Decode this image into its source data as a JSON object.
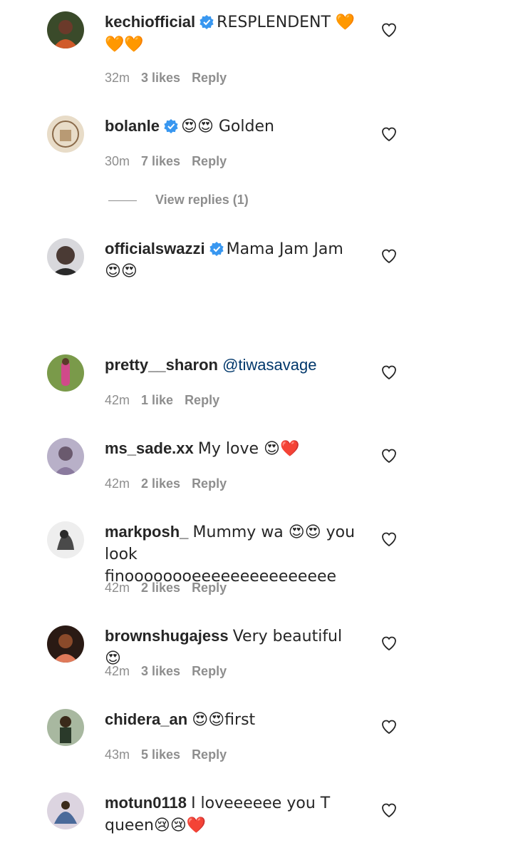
{
  "comments": [
    {
      "username": "kechiofficial",
      "verified": true,
      "text": "RESPLENDENT 🧡🧡🧡",
      "mention": "",
      "time": "32m",
      "likes": "3 likes",
      "reply": "Reply",
      "avatar_color": "#c0502a"
    },
    {
      "username": "bolanle",
      "verified": true,
      "text": "😍😍 Golden",
      "mention": "",
      "time": "30m",
      "likes": "7 likes",
      "reply": "Reply",
      "avatar_color": "#b89a74"
    },
    {
      "username": "officialswazzi",
      "verified": true,
      "text": "Mama Jam Jam 😍😍",
      "mention": "",
      "time": "",
      "likes": "",
      "reply": "",
      "avatar_color": "#3e3a3a"
    },
    {
      "username": "pretty__sharon",
      "verified": false,
      "text": "",
      "mention": "@tiwasavage",
      "time": "42m",
      "likes": "1 like",
      "reply": "Reply",
      "avatar_color": "#6a8a3a"
    },
    {
      "username": "ms_sade.xx",
      "verified": false,
      "text": "My love 😍❤️",
      "mention": "",
      "time": "42m",
      "likes": "2 likes",
      "reply": "Reply",
      "avatar_color": "#7a6a8e"
    },
    {
      "username": "markposh_",
      "verified": false,
      "text": "Mummy wa 😍😍 you look finoooooooeeeeeeeeeeeeeee",
      "mention": "",
      "time": "42m",
      "likes": "2 likes",
      "reply": "Reply",
      "avatar_color": "#d8d8d8"
    },
    {
      "username": "brownshugajess",
      "verified": false,
      "text": "Very beautiful 😍",
      "mention": "",
      "time": "42m",
      "likes": "3 likes",
      "reply": "Reply",
      "avatar_color": "#a0402a"
    },
    {
      "username": "chidera_an",
      "verified": false,
      "text": "😍😍first",
      "mention": "",
      "time": "43m",
      "likes": "5 likes",
      "reply": "Reply",
      "avatar_color": "#5a6a4a"
    },
    {
      "username": "motun0118",
      "verified": false,
      "text": "I loveeeeee you T queen😢😢❤️",
      "mention": "",
      "time": "",
      "likes": "",
      "reply": "",
      "avatar_color": "#8a9ab0"
    }
  ],
  "view_replies": "View replies (1)",
  "icons": {
    "like": "heart-outline-icon",
    "verified": "verified-badge-icon"
  }
}
